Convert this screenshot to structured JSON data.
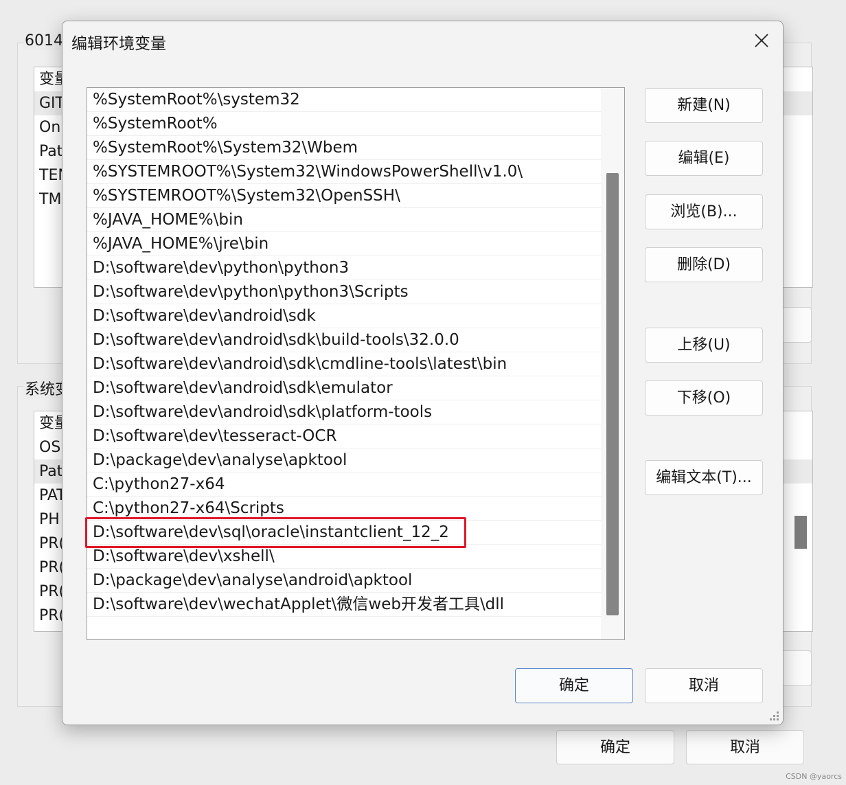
{
  "parent_window": {
    "user_group_title": "6014",
    "user_list_header": "变量",
    "user_rows": [
      "GIT",
      "On",
      "Pat",
      "TEN",
      "TM"
    ],
    "system_group_title": "系统变",
    "system_list_header": "变量",
    "system_rows": [
      "OS",
      "Pat",
      "PAT",
      "PH",
      "PR(",
      "PR(",
      "PR(",
      "PR("
    ],
    "ok_label": "确定",
    "cancel_label": "取消"
  },
  "dialog": {
    "title": "编辑环境变量",
    "close_icon": "close-icon",
    "path_entries": [
      "%SystemRoot%\\system32",
      "%SystemRoot%",
      "%SystemRoot%\\System32\\Wbem",
      "%SYSTEMROOT%\\System32\\WindowsPowerShell\\v1.0\\",
      "%SYSTEMROOT%\\System32\\OpenSSH\\",
      "%JAVA_HOME%\\bin",
      "%JAVA_HOME%\\jre\\bin",
      "D:\\software\\dev\\python\\python3",
      "D:\\software\\dev\\python\\python3\\Scripts",
      "D:\\software\\dev\\android\\sdk",
      "D:\\software\\dev\\android\\sdk\\build-tools\\32.0.0",
      "D:\\software\\dev\\android\\sdk\\cmdline-tools\\latest\\bin",
      "D:\\software\\dev\\android\\sdk\\emulator",
      "D:\\software\\dev\\android\\sdk\\platform-tools",
      "D:\\software\\dev\\tesseract-OCR",
      "D:\\package\\dev\\analyse\\apktool",
      "C:\\python27-x64",
      "C:\\python27-x64\\Scripts",
      "D:\\software\\dev\\sql\\oracle\\instantclient_12_2",
      "D:\\software\\dev\\xshell\\",
      "D:\\package\\dev\\analyse\\android\\apktool",
      "D:\\software\\dev\\wechatApplet\\微信web开发者工具\\dll"
    ],
    "highlight_color": "#e0182a",
    "buttons": {
      "new": "新建(N)",
      "edit": "编辑(E)",
      "browse": "浏览(B)...",
      "delete": "删除(D)",
      "move_up": "上移(U)",
      "move_down": "下移(O)",
      "edit_text": "编辑文本(T)...",
      "ok": "确定",
      "cancel": "取消"
    }
  },
  "watermark": "CSDN @yaorcs"
}
